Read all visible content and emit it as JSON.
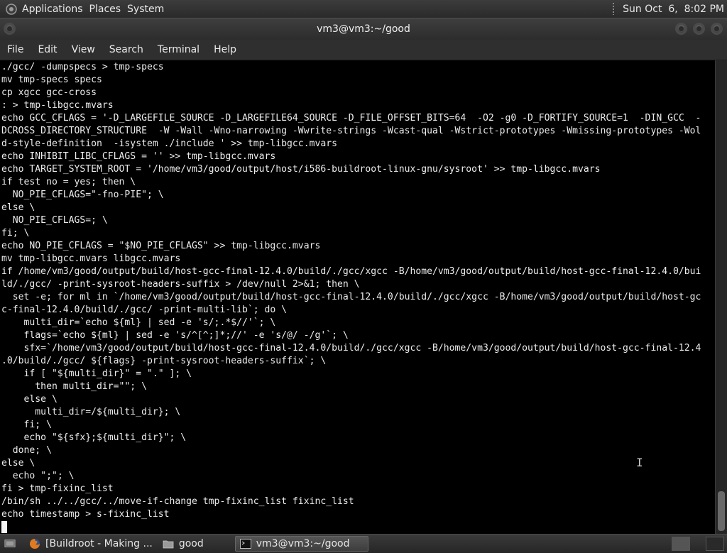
{
  "top_panel": {
    "menus": [
      "Applications",
      "Places",
      "System"
    ],
    "clock": "Sun Oct  6,  8:02 PM"
  },
  "window": {
    "title": "vm3@vm3:~/good"
  },
  "menubar": {
    "items": [
      "File",
      "Edit",
      "View",
      "Search",
      "Terminal",
      "Help"
    ]
  },
  "terminal": {
    "lines": [
      "./gcc/ -dumpspecs > tmp-specs",
      "mv tmp-specs specs",
      "cp xgcc gcc-cross",
      ": > tmp-libgcc.mvars",
      "echo GCC_CFLAGS = '-D_LARGEFILE_SOURCE -D_LARGEFILE64_SOURCE -D_FILE_OFFSET_BITS=64  -O2 -g0 -D_FORTIFY_SOURCE=1  -DIN_GCC  -",
      "DCROSS_DIRECTORY_STRUCTURE  -W -Wall -Wno-narrowing -Wwrite-strings -Wcast-qual -Wstrict-prototypes -Wmissing-prototypes -Wol",
      "d-style-definition  -isystem ./include ' >> tmp-libgcc.mvars",
      "echo INHIBIT_LIBC_CFLAGS = '' >> tmp-libgcc.mvars",
      "echo TARGET_SYSTEM_ROOT = '/home/vm3/good/output/host/i586-buildroot-linux-gnu/sysroot' >> tmp-libgcc.mvars",
      "if test no = yes; then \\",
      "  NO_PIE_CFLAGS=\"-fno-PIE\"; \\",
      "else \\",
      "  NO_PIE_CFLAGS=; \\",
      "fi; \\",
      "echo NO_PIE_CFLAGS = \"$NO_PIE_CFLAGS\" >> tmp-libgcc.mvars",
      "mv tmp-libgcc.mvars libgcc.mvars",
      "if /home/vm3/good/output/build/host-gcc-final-12.4.0/build/./gcc/xgcc -B/home/vm3/good/output/build/host-gcc-final-12.4.0/bui",
      "ld/./gcc/ -print-sysroot-headers-suffix > /dev/null 2>&1; then \\",
      "  set -e; for ml in `/home/vm3/good/output/build/host-gcc-final-12.4.0/build/./gcc/xgcc -B/home/vm3/good/output/build/host-gc",
      "c-final-12.4.0/build/./gcc/ -print-multi-lib`; do \\",
      "    multi_dir=`echo ${ml} | sed -e 's/;.*$//'`; \\",
      "    flags=`echo ${ml} | sed -e 's/^[^;]*;//' -e 's/@/ -/g'`; \\",
      "    sfx=`/home/vm3/good/output/build/host-gcc-final-12.4.0/build/./gcc/xgcc -B/home/vm3/good/output/build/host-gcc-final-12.4",
      ".0/build/./gcc/ ${flags} -print-sysroot-headers-suffix`; \\",
      "    if [ \"${multi_dir}\" = \".\" ]; \\",
      "      then multi_dir=\"\"; \\",
      "    else \\",
      "      multi_dir=/${multi_dir}; \\",
      "    fi; \\",
      "    echo \"${sfx};${multi_dir}\"; \\",
      "  done; \\",
      "else \\",
      "  echo \";\"; \\",
      "fi > tmp-fixinc_list",
      "/bin/sh ../../gcc/../move-if-change tmp-fixinc_list fixinc_list",
      "echo timestamp > s-fixinc_list"
    ]
  },
  "taskbar": {
    "tasks": [
      {
        "label": "[Buildroot - Making ...",
        "icon": "firefox-icon"
      },
      {
        "label": "good",
        "icon": "folder-icon"
      },
      {
        "label": "vm3@vm3:~/good",
        "icon": "terminal-icon"
      }
    ]
  },
  "colors": {
    "terminal_bg": "#000000",
    "terminal_fg": "#ececec",
    "panel_bg": "#2f2f2f"
  }
}
